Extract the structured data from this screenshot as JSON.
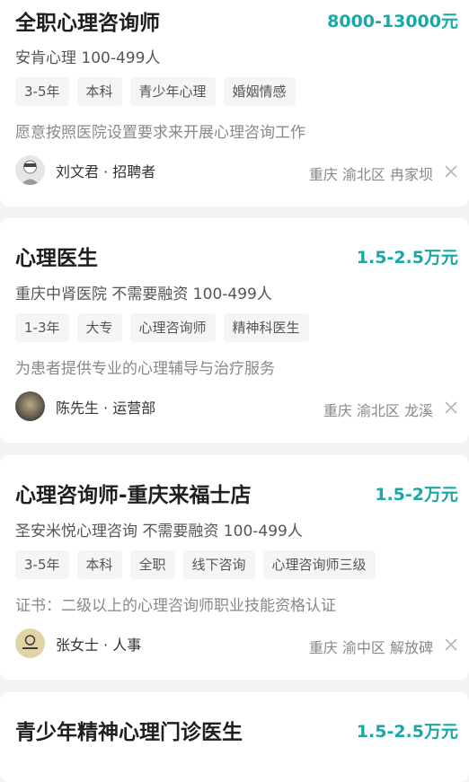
{
  "colors": {
    "salary": "#1aa7a7",
    "background": "#f2f3f5"
  },
  "jobs": [
    {
      "title": "全职心理咨询师",
      "salary": "8000-13000元",
      "company": "安肯心理 100-499人",
      "tags": [
        "3-5年",
        "本科",
        "青少年心理",
        "婚姻情感"
      ],
      "desc": "愿意按照医院设置要求来开展心理咨询工作",
      "recruiter": "刘文君 · 招聘者",
      "location": "重庆 渝北区 冉家坝"
    },
    {
      "title": "心理医生",
      "salary": "1.5-2.5万元",
      "company": "重庆中肾医院 不需要融资 100-499人",
      "tags": [
        "1-3年",
        "大专",
        "心理咨询师",
        "精神科医生"
      ],
      "desc": "为患者提供专业的心理辅导与治疗服务",
      "recruiter": "陈先生 · 运营部",
      "location": "重庆 渝北区 龙溪"
    },
    {
      "title": "心理咨询师-重庆来福士店",
      "salary": "1.5-2万元",
      "company": "圣安米悦心理咨询 不需要融资 100-499人",
      "tags": [
        "3-5年",
        "本科",
        "全职",
        "线下咨询",
        "心理咨询师三级"
      ],
      "desc": "证书：二级以上的心理咨询师职业技能资格认证",
      "recruiter": "张女士 · 人事",
      "location": "重庆 渝中区 解放碑"
    },
    {
      "title": "青少年精神心理门诊医生",
      "salary": "1.5-2.5万元"
    }
  ]
}
